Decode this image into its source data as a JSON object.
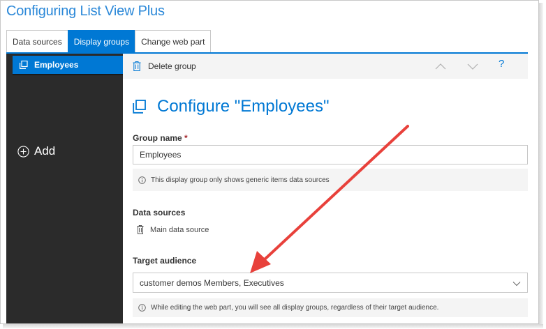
{
  "app": {
    "title": "Configuring List View Plus"
  },
  "tabs": [
    {
      "label": "Data sources",
      "active": false
    },
    {
      "label": "Display groups",
      "active": true
    },
    {
      "label": "Change web part",
      "active": false
    }
  ],
  "sidebar": {
    "items": [
      {
        "label": "Employees",
        "icon": "copy-icon",
        "selected": true
      }
    ],
    "add_label": "Add",
    "add_icon": "add-circle-icon"
  },
  "commandbar": {
    "delete_label": "Delete group",
    "delete_icon": "trash-icon",
    "move_up_icon": "chevron-up-icon",
    "move_down_icon": "chevron-down-icon",
    "help_label": "?"
  },
  "form": {
    "heading": "Configure \"Employees\"",
    "heading_icon": "copy-icon",
    "group_name": {
      "label": "Group name",
      "required_marker": "*",
      "value": "Employees",
      "info": "This display group only shows generic items data sources"
    },
    "data_sources": {
      "label": "Data sources",
      "items": [
        {
          "label": "Main data source",
          "icon": "trash-icon"
        }
      ]
    },
    "target_audience": {
      "label": "Target audience",
      "value": "customer demos Members, Executives",
      "info": "While editing the web part, you will see all display groups, regardless of their target audience."
    }
  },
  "colors": {
    "accent": "#0078d4",
    "title": "#2b88d8",
    "sidebar_bg": "#2b2b2b",
    "annotation_arrow": "#e8413b"
  }
}
